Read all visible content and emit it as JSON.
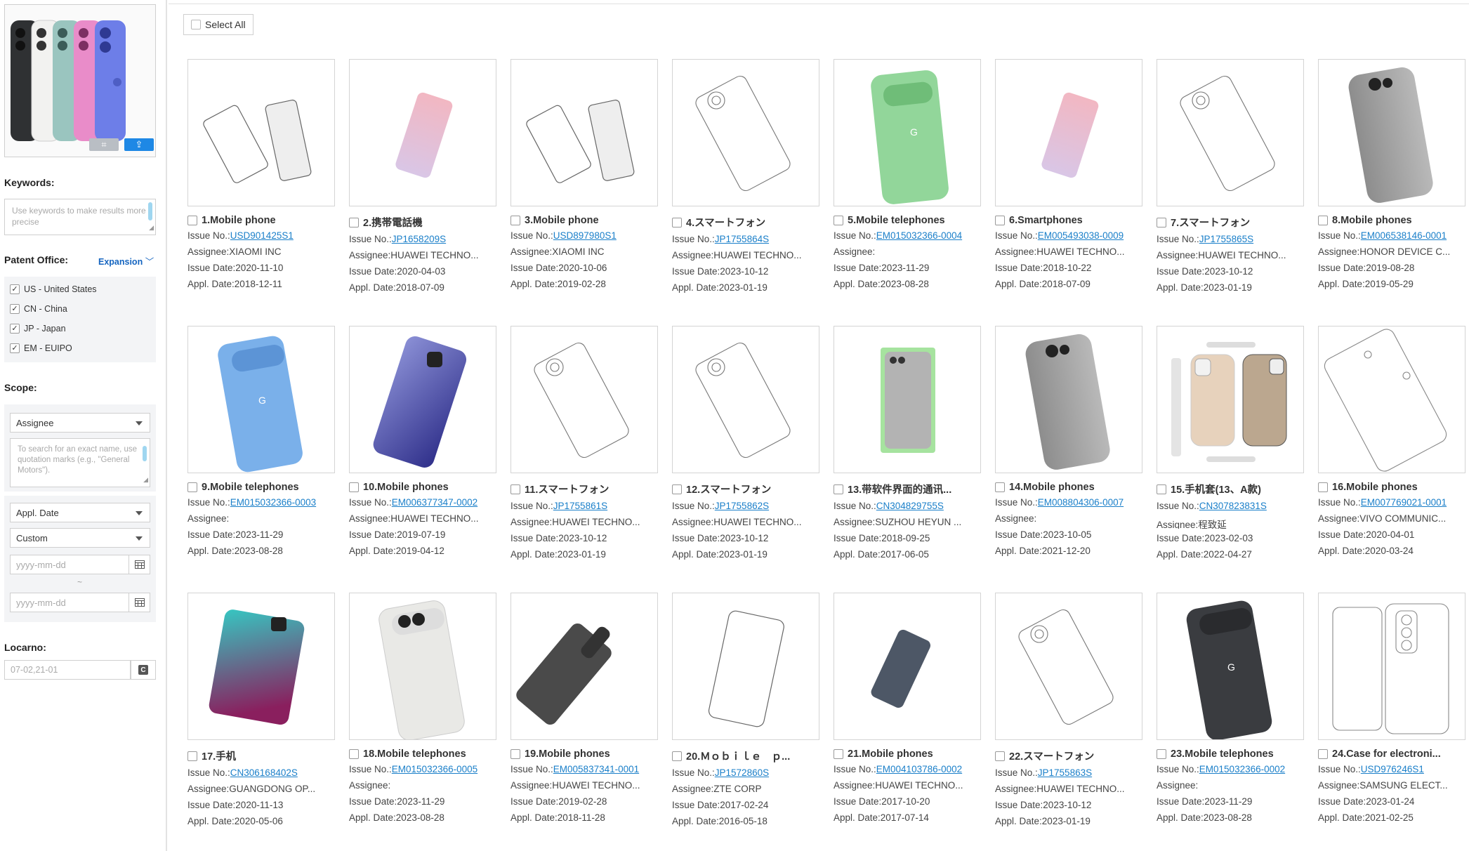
{
  "sidebar": {
    "keywords_label": "Keywords:",
    "keywords_placeholder": "Use keywords to make results more precise",
    "patent_office_label": "Patent Office:",
    "expansion_label": "Expansion",
    "offices": [
      "US - United States",
      "CN - China",
      "JP - Japan",
      "EM - EUIPO"
    ],
    "scope_label": "Scope:",
    "scope_select": "Assignee",
    "scope_placeholder": "To search for an exact name, use quotation marks (e.g., \"General Motors\").",
    "date_type_select": "Appl. Date",
    "date_range_select": "Custom",
    "date_placeholder": "yyyy-mm-dd",
    "date_separator": "~",
    "locarno_label": "Locarno:",
    "locarno_value": "07-02,21-01"
  },
  "main": {
    "select_all": "Select All",
    "labels": {
      "issue_no": "Issue No.:",
      "assignee": "Assignee:",
      "issue_date": "Issue Date:",
      "appl_date": "Appl. Date:"
    },
    "results": [
      {
        "title": "1.Mobile phone",
        "issue_no": "USD901425S1",
        "assignee": "XIAOMI INC",
        "issue_date": "2020-11-10",
        "appl_date": "2018-12-11",
        "img": "outline-pair"
      },
      {
        "title": "2.携帯電話機",
        "issue_no": "JP1658209S",
        "assignee": "HUAWEI TECHNO...",
        "issue_date": "2020-04-03",
        "appl_date": "2018-07-09",
        "img": "pink"
      },
      {
        "title": "3.Mobile phone",
        "issue_no": "USD897980S1",
        "assignee": "XIAOMI INC",
        "issue_date": "2020-10-06",
        "appl_date": "2019-02-28",
        "img": "outline-pair"
      },
      {
        "title": "4.スマートフォン",
        "issue_no": "JP1755864S",
        "assignee": "HUAWEI TECHNO...",
        "issue_date": "2023-10-12",
        "appl_date": "2023-01-19",
        "img": "outline-cam"
      },
      {
        "title": "5.Mobile telephones",
        "issue_no": "EM015032366-0004",
        "assignee": "",
        "issue_date": "2023-11-29",
        "appl_date": "2023-08-28",
        "img": "green"
      },
      {
        "title": "6.Smartphones",
        "issue_no": "EM005493038-0009",
        "assignee": "HUAWEI TECHNO...",
        "issue_date": "2018-10-22",
        "appl_date": "2018-07-09",
        "img": "pink"
      },
      {
        "title": "7.スマートフォン",
        "issue_no": "JP1755865S",
        "assignee": "HUAWEI TECHNO...",
        "issue_date": "2023-10-12",
        "appl_date": "2023-01-19",
        "img": "outline-cam"
      },
      {
        "title": "8.Mobile phones",
        "issue_no": "EM006538146-0001",
        "assignee": "HONOR DEVICE C...",
        "issue_date": "2019-08-28",
        "appl_date": "2019-05-29",
        "img": "grey"
      },
      {
        "title": "9.Mobile telephones",
        "issue_no": "EM015032366-0003",
        "assignee": "",
        "issue_date": "2023-11-29",
        "appl_date": "2023-08-28",
        "img": "blue"
      },
      {
        "title": "10.Mobile phones",
        "issue_no": "EM006377347-0002",
        "assignee": "HUAWEI TECHNO...",
        "issue_date": "2019-07-19",
        "appl_date": "2019-04-12",
        "img": "purple"
      },
      {
        "title": "11.スマートフォン",
        "issue_no": "JP1755861S",
        "assignee": "HUAWEI TECHNO...",
        "issue_date": "2023-10-12",
        "appl_date": "2023-01-19",
        "img": "outline-cam"
      },
      {
        "title": "12.スマートフォン",
        "issue_no": "JP1755862S",
        "assignee": "HUAWEI TECHNO...",
        "issue_date": "2023-10-12",
        "appl_date": "2023-01-19",
        "img": "outline-cam"
      },
      {
        "title": "13.带软件界面的通讯...",
        "issue_no": "CN304829755S",
        "assignee": "SUZHOU HEYUN ...",
        "issue_date": "2018-09-25",
        "appl_date": "2017-06-05",
        "img": "silver-front"
      },
      {
        "title": "14.Mobile phones",
        "issue_no": "EM008804306-0007",
        "assignee": "",
        "issue_date": "2023-10-05",
        "appl_date": "2021-12-20",
        "img": "grey"
      },
      {
        "title": "15.手机套(13、A款)",
        "issue_no": "CN307823831S",
        "assignee": "程致延",
        "issue_date": "2023-02-03",
        "appl_date": "2022-04-27",
        "img": "case"
      },
      {
        "title": "16.Mobile phones",
        "issue_no": "EM007769021-0001",
        "assignee": "VIVO COMMUNIC...",
        "issue_date": "2020-04-01",
        "appl_date": "2020-03-24",
        "img": "outline-flat"
      },
      {
        "title": "17.手机",
        "issue_no": "CN306168402S",
        "assignee": "GUANGDONG OP...",
        "issue_date": "2020-11-13",
        "appl_date": "2020-05-06",
        "img": "gradient"
      },
      {
        "title": "18.Mobile telephones",
        "issue_no": "EM015032366-0005",
        "assignee": "",
        "issue_date": "2023-11-29",
        "appl_date": "2023-08-28",
        "img": "white"
      },
      {
        "title": "19.Mobile phones",
        "issue_no": "EM005837341-0001",
        "assignee": "HUAWEI TECHNO...",
        "issue_date": "2019-02-28",
        "appl_date": "2018-11-28",
        "img": "dark-flat"
      },
      {
        "title": "20.Ｍｏｂｉｌｅ　ｐ...",
        "issue_no": "JP1572860S",
        "assignee": "ZTE CORP",
        "issue_date": "2017-02-24",
        "appl_date": "2016-05-18",
        "img": "outline-front"
      },
      {
        "title": "21.Mobile phones",
        "issue_no": "EM004103786-0002",
        "assignee": "HUAWEI TECHNO...",
        "issue_date": "2017-10-20",
        "appl_date": "2017-07-14",
        "img": "slate"
      },
      {
        "title": "22.スマートフォン",
        "issue_no": "JP1755863S",
        "assignee": "HUAWEI TECHNO...",
        "issue_date": "2023-10-12",
        "appl_date": "2023-01-19",
        "img": "outline-cam"
      },
      {
        "title": "23.Mobile telephones",
        "issue_no": "EM015032366-0002",
        "assignee": "",
        "issue_date": "2023-11-29",
        "appl_date": "2023-08-28",
        "img": "black"
      },
      {
        "title": "24.Case for electroni...",
        "issue_no": "USD976246S1",
        "assignee": "SAMSUNG ELECT...",
        "issue_date": "2023-01-24",
        "appl_date": "2021-02-25",
        "img": "outline-case"
      }
    ]
  },
  "colors": {
    "link": "#1a7fc9",
    "accent": "#1e88e5",
    "expansion": "#1565c0"
  },
  "icons": [
    "crop-icon",
    "upload-icon",
    "chevron-down-icon",
    "checkbox-icon",
    "calendar-icon",
    "locarno-picker-icon",
    "resize-icon"
  ]
}
